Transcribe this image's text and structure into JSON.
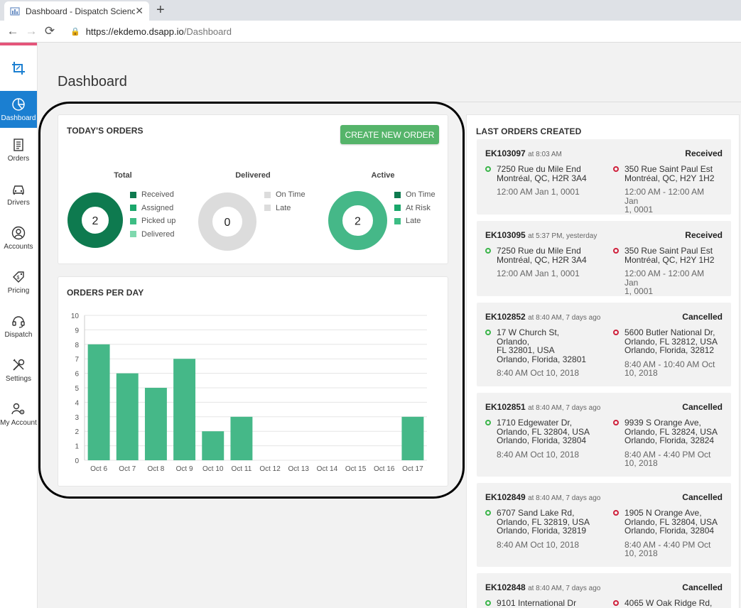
{
  "browser": {
    "tab_title": "Dashboard - Dispatch Science",
    "url_host": "https://ekdemo.dsapp.io",
    "url_path": "/Dashboard"
  },
  "sidebar": {
    "items": [
      {
        "label": "Dashboard",
        "icon": "pie-chart-icon",
        "active": true
      },
      {
        "label": "Orders",
        "icon": "document-icon"
      },
      {
        "label": "Drivers",
        "icon": "car-icon"
      },
      {
        "label": "Accounts",
        "icon": "user-circle-icon"
      },
      {
        "label": "Pricing",
        "icon": "price-tag-icon"
      },
      {
        "label": "Dispatch",
        "icon": "headset-icon"
      },
      {
        "label": "Settings",
        "icon": "tools-icon"
      },
      {
        "label": "My Account",
        "icon": "user-gear-icon"
      }
    ]
  },
  "page_title": "Dashboard",
  "todays_orders": {
    "title": "TODAY'S ORDERS",
    "create_button": "CREATE NEW ORDER",
    "donuts": [
      {
        "label": "Total",
        "value": "2",
        "legend": [
          {
            "name": "Received",
            "color": "#0e7a4f"
          },
          {
            "name": "Assigned",
            "color": "#1aa76b"
          },
          {
            "name": "Picked up",
            "color": "#3dbd84"
          },
          {
            "name": "Delivered",
            "color": "#7fd8ae"
          }
        ]
      },
      {
        "label": "Delivered",
        "value": "0",
        "legend": [
          {
            "name": "On Time",
            "color": "#dcdcdc"
          },
          {
            "name": "Late",
            "color": "#dcdcdc"
          }
        ]
      },
      {
        "label": "Active",
        "value": "2",
        "legend": [
          {
            "name": "On Time",
            "color": "#0e7a4f"
          },
          {
            "name": "At Risk",
            "color": "#1aa76b"
          },
          {
            "name": "Late",
            "color": "#3dbd84"
          }
        ]
      }
    ]
  },
  "orders_per_day": {
    "title": "ORDERS PER DAY"
  },
  "chart_data": {
    "type": "bar",
    "categories": [
      "Oct 6",
      "Oct 7",
      "Oct 8",
      "Oct 9",
      "Oct 10",
      "Oct 11",
      "Oct 12",
      "Oct 13",
      "Oct 14",
      "Oct 15",
      "Oct 16",
      "Oct 17"
    ],
    "values": [
      8,
      6,
      5,
      7,
      2,
      3,
      0,
      0,
      0,
      0,
      0,
      3
    ],
    "title": "",
    "xlabel": "",
    "ylabel": "",
    "ylim": [
      0,
      10
    ],
    "yticks": [
      0,
      1,
      2,
      3,
      4,
      5,
      6,
      7,
      8,
      9,
      10
    ],
    "grid": true,
    "bar_color": "#45b888"
  },
  "last_orders": {
    "title": "LAST ORDERS CREATED",
    "orders": [
      {
        "id": "EK103097",
        "time": "at 8:03 AM",
        "status": "Received",
        "pickup_addr": [
          "7250 Rue du Mile End",
          "Montréal, QC, H2R 3A4"
        ],
        "pickup_when": [
          "12:00 AM Jan 1, 0001"
        ],
        "drop_addr": [
          "350 Rue Saint Paul Est",
          "Montréal, QC, H2Y 1H2"
        ],
        "drop_when": [
          "12:00 AM - 12:00 AM Jan",
          "1, 0001"
        ]
      },
      {
        "id": "EK103095",
        "time": "at 5:37 PM, yesterday",
        "status": "Received",
        "pickup_addr": [
          "7250 Rue du Mile End",
          "Montréal, QC, H2R 3A4"
        ],
        "pickup_when": [
          "12:00 AM Jan 1, 0001"
        ],
        "drop_addr": [
          "350 Rue Saint Paul Est",
          "Montréal, QC, H2Y 1H2"
        ],
        "drop_when": [
          "12:00 AM - 12:00 AM Jan",
          "1, 0001"
        ]
      },
      {
        "id": "EK102852",
        "time": "at 8:40 AM, 7 days ago",
        "status": "Cancelled",
        "pickup_addr": [
          "17 W Church St, Orlando,",
          "FL 32801, USA",
          "Orlando, Florida, 32801"
        ],
        "pickup_when": [
          "8:40 AM Oct 10, 2018"
        ],
        "drop_addr": [
          "5600 Butler National Dr,",
          "Orlando, FL 32812, USA",
          "Orlando, Florida, 32812"
        ],
        "drop_when": [
          "8:40 AM - 10:40 AM Oct",
          "10, 2018"
        ]
      },
      {
        "id": "EK102851",
        "time": "at 8:40 AM, 7 days ago",
        "status": "Cancelled",
        "pickup_addr": [
          "1710 Edgewater Dr,",
          "Orlando, FL 32804, USA",
          "Orlando, Florida, 32804"
        ],
        "pickup_when": [
          "8:40 AM Oct 10, 2018"
        ],
        "drop_addr": [
          "9939 S Orange Ave,",
          "Orlando, FL 32824, USA",
          "Orlando, Florida, 32824"
        ],
        "drop_when": [
          "8:40 AM - 4:40 PM Oct",
          "10, 2018"
        ]
      },
      {
        "id": "EK102849",
        "time": "at 8:40 AM, 7 days ago",
        "status": "Cancelled",
        "pickup_addr": [
          "6707 Sand Lake Rd,",
          "Orlando, FL 32819, USA",
          "Orlando, Florida, 32819"
        ],
        "pickup_when": [
          "8:40 AM Oct 10, 2018"
        ],
        "drop_addr": [
          "1905 N Orange Ave,",
          "Orlando, FL 32804, USA",
          "Orlando, Florida, 32804"
        ],
        "drop_when": [
          "8:40 AM - 4:40 PM Oct",
          "10, 2018"
        ]
      },
      {
        "id": "EK102848",
        "time": "at 8:40 AM, 7 days ago",
        "status": "Cancelled",
        "pickup_addr": [
          "9101 International Dr"
        ],
        "pickup_when": [],
        "drop_addr": [
          "4065 W Oak Ridge Rd,"
        ],
        "drop_when": []
      }
    ]
  },
  "colors": {
    "accent_blue": "#1b7fd1",
    "create_green": "#55b46a",
    "pickup_dot": "#3bb54a",
    "dropoff_dot": "#d0213c",
    "sidebar_top": "#e4557a"
  }
}
